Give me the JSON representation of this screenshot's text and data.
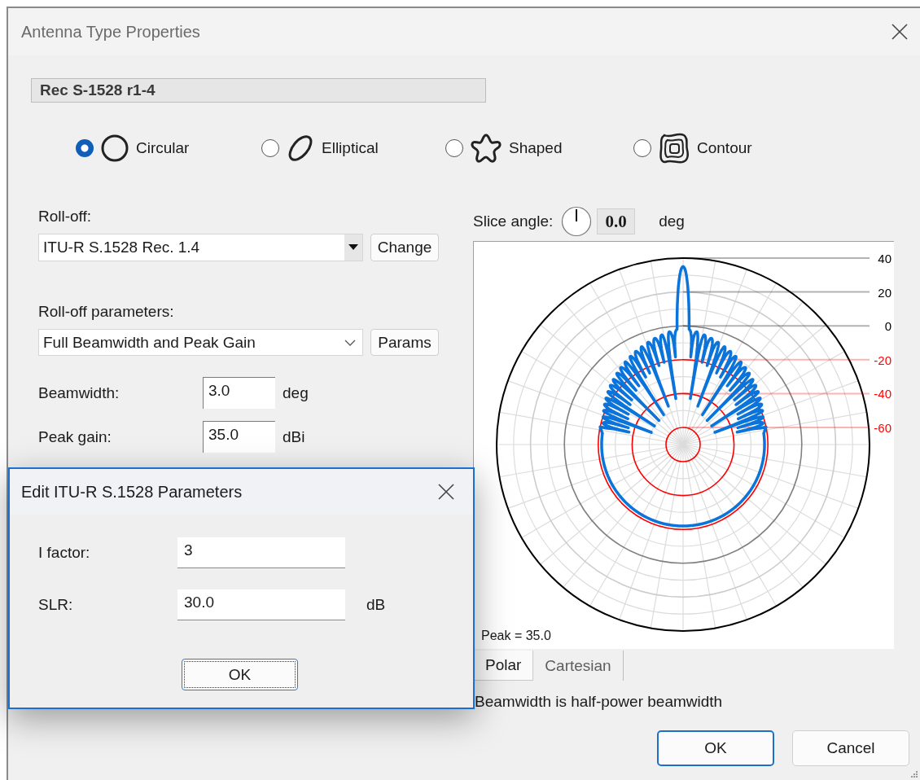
{
  "window": {
    "title": "Antenna Type Properties"
  },
  "antenna_name": "Rec S-1528 r1-4",
  "shape_options": [
    {
      "label": "Circular",
      "kind": "circular",
      "selected": true
    },
    {
      "label": "Elliptical",
      "kind": "elliptical",
      "selected": false
    },
    {
      "label": "Shaped",
      "kind": "shaped",
      "selected": false
    },
    {
      "label": "Contour",
      "kind": "contour",
      "selected": false
    }
  ],
  "rolloff": {
    "label": "Roll-off:",
    "value": "ITU-R S.1528 Rec. 1.4",
    "button": "Change"
  },
  "rolloff_parameters": {
    "label": "Roll-off parameters:",
    "value": "Full Beamwidth and Peak Gain",
    "button": "Params"
  },
  "fields": [
    {
      "label": "Beamwidth:",
      "value": "3.0",
      "unit": "deg"
    },
    {
      "label": "Peak gain:",
      "value": "35.0",
      "unit": "dBi"
    }
  ],
  "slice_angle": {
    "label": "Slice angle:",
    "value": "0.0",
    "unit": "deg"
  },
  "pattern_plot": {
    "ring_labels": [
      {
        "text": "40",
        "color": "#000000"
      },
      {
        "text": "20",
        "color": "#000000"
      },
      {
        "text": "0",
        "color": "#000000"
      },
      {
        "text": "-20",
        "color": "#ff0000"
      },
      {
        "text": "-40",
        "color": "#ff0000"
      },
      {
        "text": "-60",
        "color": "#ff0000"
      }
    ],
    "peak_label": "Peak = 35.0"
  },
  "plot_tabs": [
    {
      "label": "Polar",
      "selected": true
    },
    {
      "label": "Cartesian",
      "selected": false
    }
  ],
  "note": "Beamwidth is half-power beamwidth",
  "buttons": [
    {
      "label": "OK",
      "kind": "default"
    },
    {
      "label": "Cancel",
      "kind": "normal"
    }
  ],
  "params_dialog": {
    "title": "Edit ITU-R S.1528 Parameters",
    "fields": [
      {
        "label": "I factor:",
        "value": "3"
      },
      {
        "label": "SLR:",
        "value": "30.0",
        "unit": "dB"
      }
    ],
    "button": "OK"
  }
}
